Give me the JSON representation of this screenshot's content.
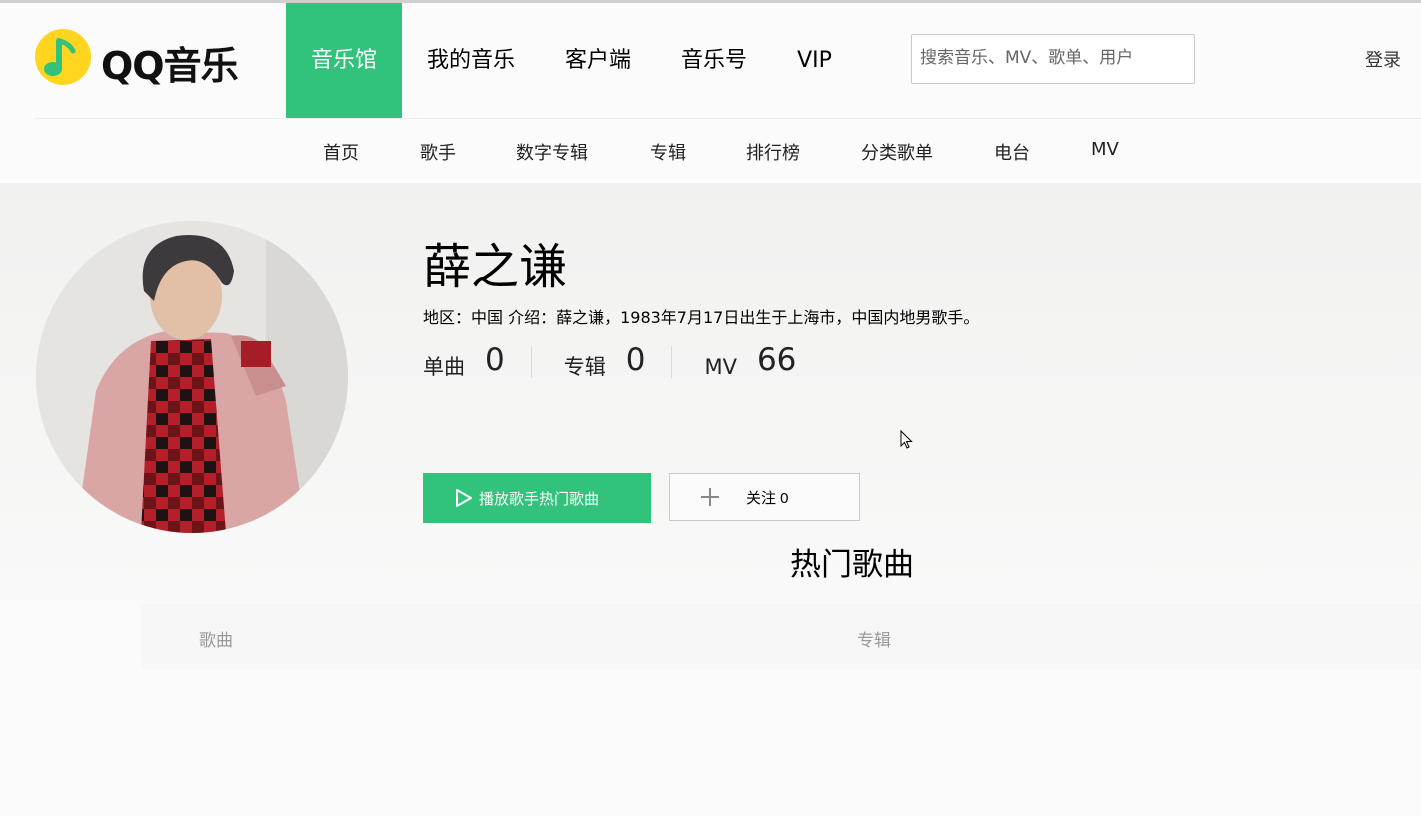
{
  "logo": {
    "text": "QQ音乐",
    "brand_color": "#31c27c",
    "mark_color": "#ffd51f"
  },
  "main_nav": [
    {
      "label": "音乐馆",
      "active": true
    },
    {
      "label": "我的音乐",
      "active": false
    },
    {
      "label": "客户端",
      "active": false
    },
    {
      "label": "音乐号",
      "active": false
    },
    {
      "label": "VIP",
      "active": false
    }
  ],
  "search": {
    "placeholder": "搜索音乐、MV、歌单、用户",
    "value": ""
  },
  "login": {
    "label": "登录"
  },
  "sub_nav": [
    "首页",
    "歌手",
    "数字专辑",
    "专辑",
    "排行榜",
    "分类歌单",
    "电台",
    "MV"
  ],
  "singer": {
    "name": "薛之谦",
    "info": "地区：中国   介绍：薛之谦，1983年7月17日出生于上海市，中国内地男歌手。",
    "stats": [
      {
        "label": "单曲",
        "value": "0"
      },
      {
        "label": "专辑",
        "value": "0"
      },
      {
        "label": "MV",
        "value": "66"
      }
    ]
  },
  "actions": {
    "play_label": "播放歌手热门歌曲",
    "follow_label": "关注 0"
  },
  "hot_songs": {
    "title": "热门歌曲",
    "columns": [
      "歌曲",
      "专辑"
    ]
  },
  "icons": {
    "play": "play-icon",
    "plus": "plus-icon",
    "cursor": "mouse-cursor-icon"
  }
}
